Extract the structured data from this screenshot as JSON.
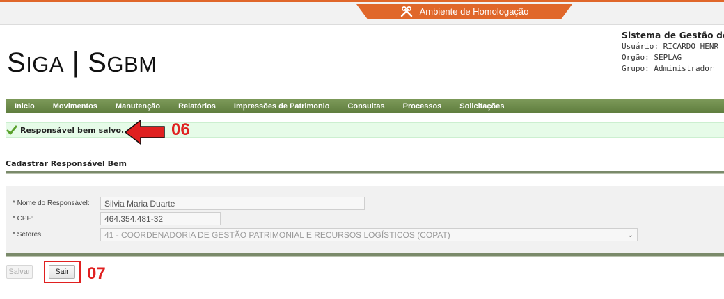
{
  "environment": {
    "label": "Ambiente de Homologação",
    "icon": "tools-icon"
  },
  "logo": {
    "part1_big": "S",
    "part1_small": "IGA",
    "separator": " | ",
    "part2_big": "S",
    "part2_small": "GBM"
  },
  "system_info": {
    "title": "Sistema de Gestão de",
    "user": "Usuário: RICARDO HENR",
    "org": "Orgão: SEPLAG",
    "group": "Grupo: Administrador"
  },
  "menu": [
    "Inicio",
    "Movimentos",
    "Manutenção",
    "Relatórios",
    "Impressões de Patrimonio",
    "Consultas",
    "Processos",
    "Solicitações"
  ],
  "success_message": "Responsável bem salvo.",
  "annotations": {
    "step1": "06",
    "step2": "07"
  },
  "section_title": "Cadastrar Responsável Bem",
  "form": {
    "name_label": "* Nome do Responsável:",
    "name_value": "Silvia Maria Duarte",
    "cpf_label": "* CPF:",
    "cpf_value": "464.354.481-32",
    "sectors_label": "* Setores:",
    "sectors_value": "41 - COORDENADORIA DE GESTÃO PATRIMONIAL E RECURSOS LOGÍSTICOS (COPAT)"
  },
  "buttons": {
    "save": "Salvar",
    "exit": "Sair"
  },
  "colors": {
    "accent": "#e0672a",
    "menu_green": "#6b8a48",
    "success_bg": "#e6fbe8",
    "annotation_red": "#e02020"
  }
}
